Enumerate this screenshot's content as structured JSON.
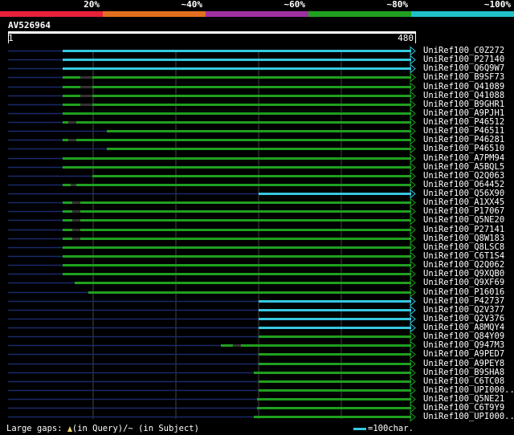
{
  "legend": [
    {
      "label": "20%",
      "color": "#e8203a"
    },
    {
      "label": "~40%",
      "color": "#e07020"
    },
    {
      "label": "~60%",
      "color": "#a030a0"
    },
    {
      "label": "~80%",
      "color": "#20a020"
    },
    {
      "label": "~100%",
      "color": "#20c0c8"
    }
  ],
  "query": {
    "id": "AV526964",
    "start": "1",
    "end": "480"
  },
  "colors": {
    "cyan": "#36c8e0",
    "green": "#1fa01f",
    "navy": "#1a2a6a",
    "grid": "#444444",
    "gap": "#e8d070"
  },
  "rows": [
    {
      "label": "UniRef100_C0Z272",
      "color": "cyan"
    },
    {
      "label": "UniRef100_P27140",
      "color": "cyan"
    },
    {
      "label": "UniRef100_Q6Q9W7",
      "color": "cyan"
    },
    {
      "label": "UniRef100_B9SF73",
      "color": "green"
    },
    {
      "label": "UniRef100_Q41089",
      "color": "green"
    },
    {
      "label": "UniRef100_Q41088",
      "color": "green"
    },
    {
      "label": "UniRef100_B9GHR1",
      "color": "green"
    },
    {
      "label": "UniRef100_A9PJH1",
      "color": "green"
    },
    {
      "label": "UniRef100_P46512",
      "color": "green"
    },
    {
      "label": "UniRef100_P46511",
      "color": "green"
    },
    {
      "label": "UniRef100_P46281",
      "color": "green"
    },
    {
      "label": "UniRef100_P46510",
      "color": "green"
    },
    {
      "label": "UniRef100_A7PM94",
      "color": "green"
    },
    {
      "label": "UniRef100_A5BQL5",
      "color": "green"
    },
    {
      "label": "UniRef100_Q2Q063",
      "color": "green"
    },
    {
      "label": "UniRef100_O64452",
      "color": "green"
    },
    {
      "label": "UniRef100_Q56X90",
      "color": "cyan"
    },
    {
      "label": "UniRef100_A1XX45",
      "color": "green"
    },
    {
      "label": "UniRef100_P17067",
      "color": "green"
    },
    {
      "label": "UniRef100_Q5NE20",
      "color": "green"
    },
    {
      "label": "UniRef100_P27141",
      "color": "green"
    },
    {
      "label": "UniRef100_Q8W183",
      "color": "green"
    },
    {
      "label": "UniRef100_Q8LSC8",
      "color": "green"
    },
    {
      "label": "UniRef100_C6T1S4",
      "color": "green"
    },
    {
      "label": "UniRef100_Q2Q062",
      "color": "green"
    },
    {
      "label": "UniRef100_Q9XQB0",
      "color": "green"
    },
    {
      "label": "UniRef100_Q9XF69",
      "color": "green"
    },
    {
      "label": "UniRef100_P16016",
      "color": "green"
    },
    {
      "label": "UniRef100_P42737",
      "color": "cyan"
    },
    {
      "label": "UniRef100_Q2V377",
      "color": "cyan"
    },
    {
      "label": "UniRef100_Q2V376",
      "color": "cyan"
    },
    {
      "label": "UniRef100_A8MQY4",
      "color": "cyan"
    },
    {
      "label": "UniRef100_Q84Y09",
      "color": "green"
    },
    {
      "label": "UniRef100_Q947M3",
      "color": "green"
    },
    {
      "label": "UniRef100_A9PED7",
      "color": "green"
    },
    {
      "label": "UniRef100_A9PEY8",
      "color": "green"
    },
    {
      "label": "UniRef100_B9SHA8",
      "color": "green"
    },
    {
      "label": "UniRef100_C6TC08",
      "color": "green"
    },
    {
      "label": "UniRef100_UPI000..",
      "color": "green"
    },
    {
      "label": "UniRef100_Q5NE21",
      "color": "green"
    },
    {
      "label": "UniRef100_C6T9Y9",
      "color": "green"
    },
    {
      "label": "UniRef100_UPI000..",
      "color": "green"
    }
  ],
  "footer": {
    "gaps_label": "Large gaps:",
    "in_query": "(in Query)/",
    "in_subject": "~ (in Subject)",
    "scale": "=100char."
  }
}
